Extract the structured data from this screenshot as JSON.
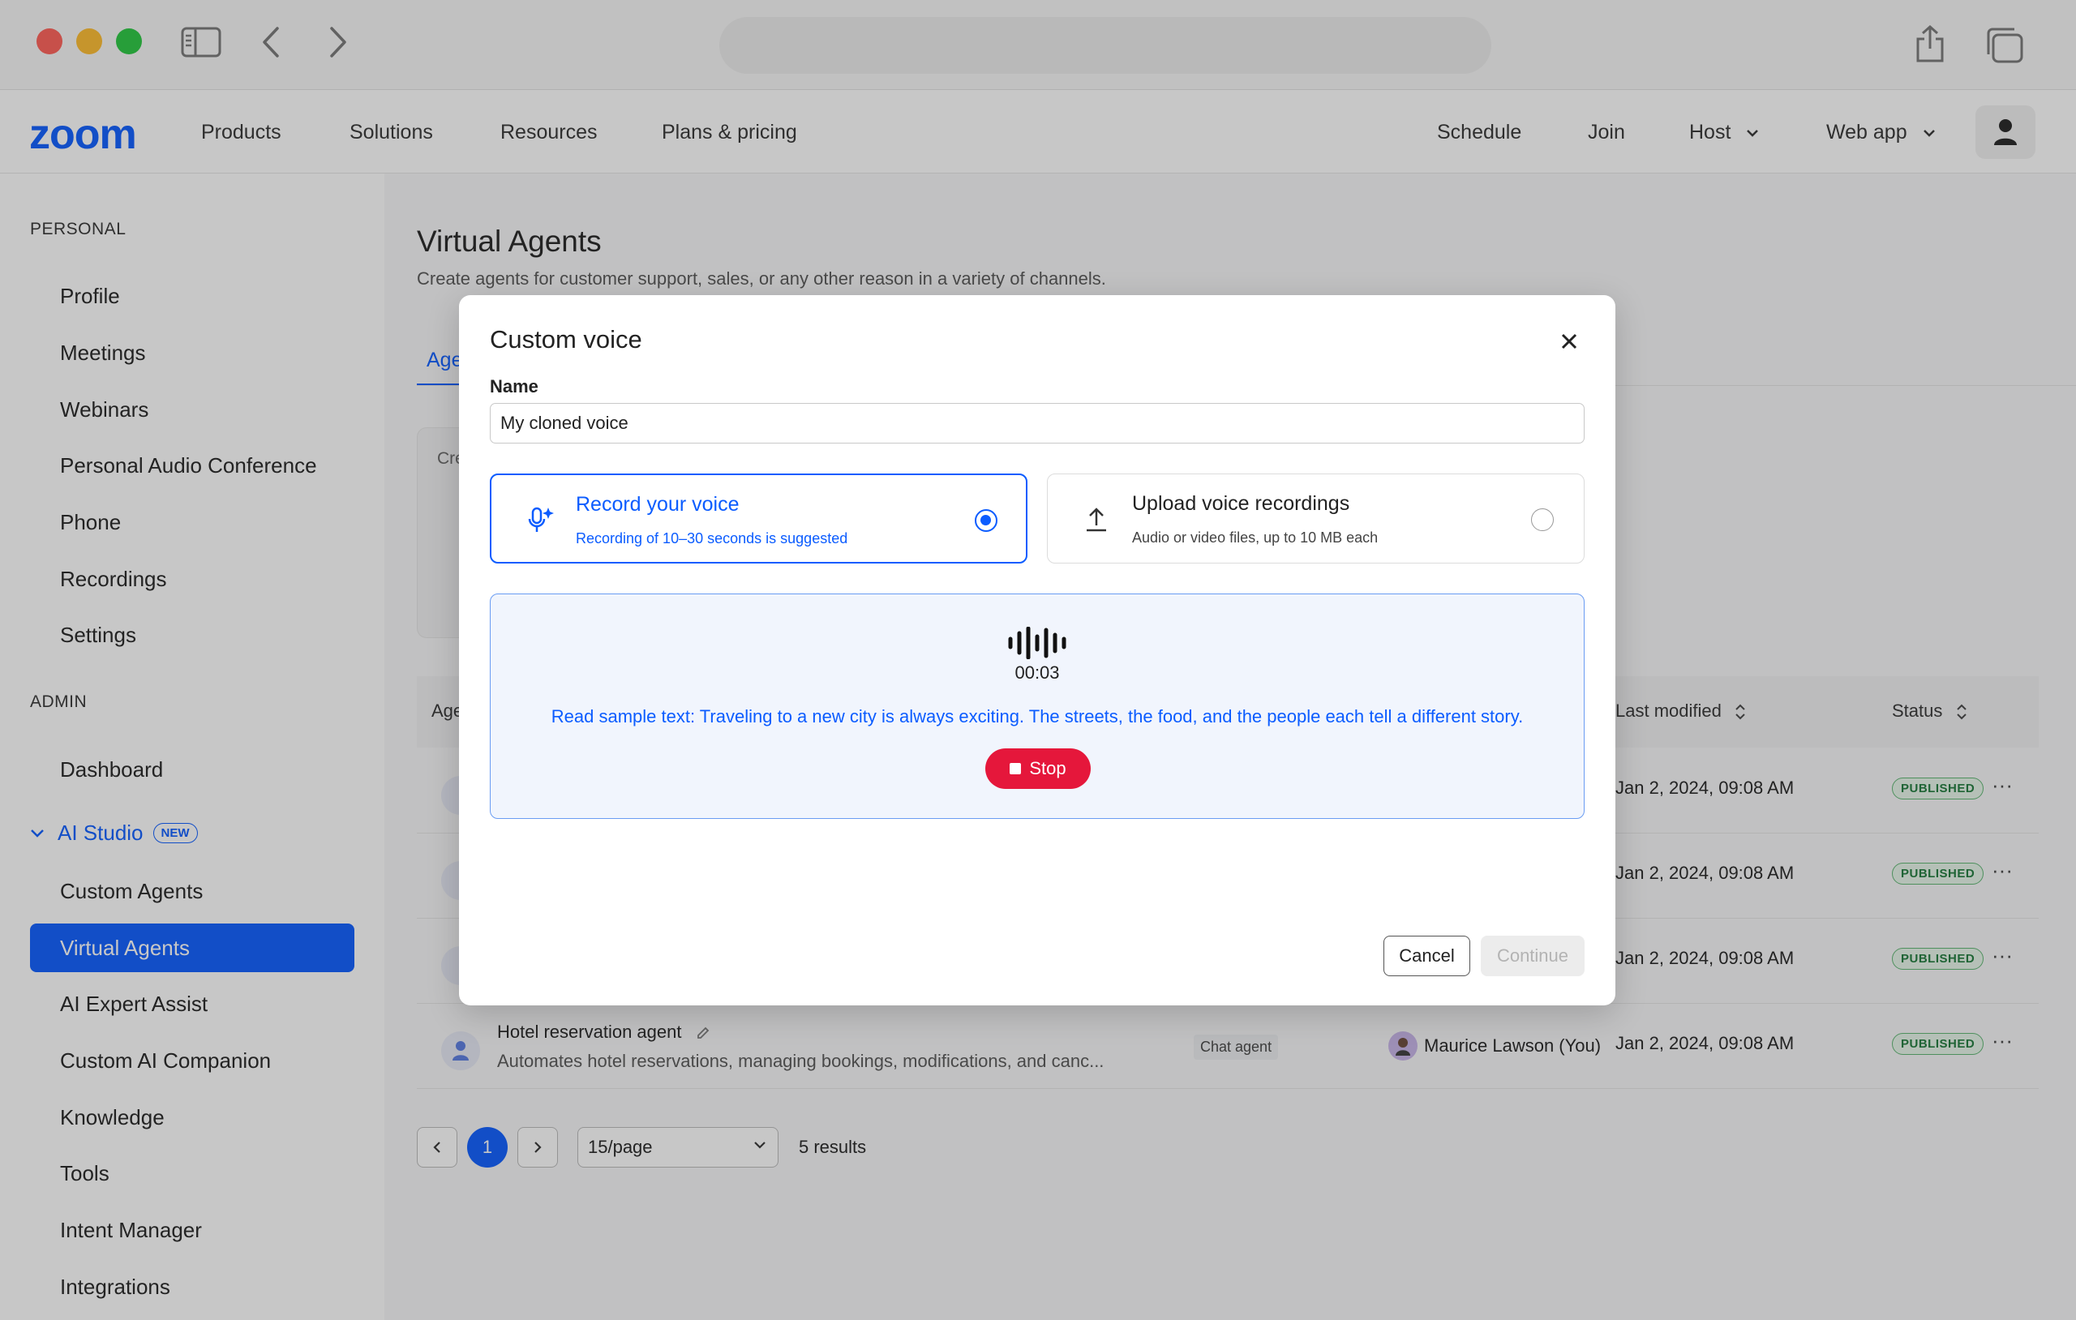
{
  "nav": {
    "logo": "zoom",
    "links": [
      "Products",
      "Solutions",
      "Resources",
      "Plans & pricing"
    ],
    "right": [
      "Schedule",
      "Join",
      "Host",
      "Web app"
    ]
  },
  "sidebar": {
    "personal_label": "PERSONAL",
    "personal_items": [
      "Profile",
      "Meetings",
      "Webinars",
      "Personal Audio Conference",
      "Phone",
      "Recordings",
      "Settings"
    ],
    "admin_label": "ADMIN",
    "dashboard": "Dashboard",
    "ai_studio": "AI Studio",
    "new_badge": "NEW",
    "ai_items": [
      "Custom Agents",
      "Virtual Agents",
      "AI Expert Assist",
      "Custom AI Companion",
      "Knowledge",
      "Tools",
      "Intent Manager",
      "Integrations"
    ]
  },
  "main": {
    "title": "Virtual Agents",
    "subtitle": "Create agents for customer support, sales, or any other reason in a variety of channels.",
    "tab_fragment": "Age",
    "create_fragment": "Cre",
    "table": {
      "col_agent_fragment": "Age",
      "col_modified": "Last modified",
      "col_status": "Status",
      "rows": [
        {
          "modified": "Jan 2, 2024, 09:08 AM",
          "status": "PUBLISHED"
        },
        {
          "modified": "Jan 2, 2024, 09:08 AM",
          "status": "PUBLISHED"
        },
        {
          "modified": "Jan 2, 2024, 09:08 AM",
          "status": "PUBLISHED"
        },
        {
          "name": "Hotel reservation agent",
          "desc": "Automates hotel reservations, managing bookings, modifications, and canc...",
          "type": "Chat agent",
          "owner": "Maurice Lawson (You)",
          "modified": "Jan 2, 2024, 09:08 AM",
          "status": "PUBLISHED"
        }
      ]
    },
    "pagination": {
      "page": "1",
      "per_page": "15/page",
      "results": "5 results"
    }
  },
  "modal": {
    "title": "Custom voice",
    "name_label": "Name",
    "name_value": "My cloned voice",
    "option_record": {
      "title": "Record your voice",
      "subtitle": "Recording of 10–30 seconds is suggested"
    },
    "option_upload": {
      "title": "Upload voice recordings",
      "subtitle": "Audio or video files, up to 10 MB each"
    },
    "timer": "00:03",
    "sample_text": "Read sample text: Traveling to a new city is always exciting. The streets, the food, and the people each tell a different story.",
    "stop_label": "Stop",
    "cancel_label": "Cancel",
    "continue_label": "Continue"
  }
}
